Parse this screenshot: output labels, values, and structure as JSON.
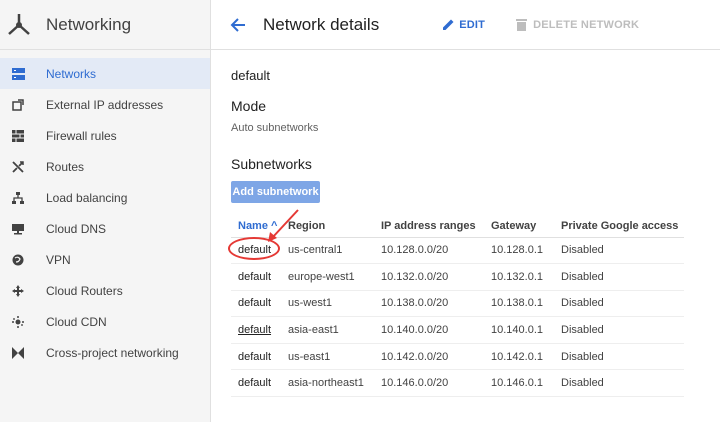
{
  "app": {
    "title": "Networking"
  },
  "sidebar": {
    "items": [
      {
        "label": "Networks",
        "icon": "networks-icon",
        "active": true
      },
      {
        "label": "External IP addresses",
        "icon": "external-ip-icon"
      },
      {
        "label": "Firewall rules",
        "icon": "firewall-icon"
      },
      {
        "label": "Routes",
        "icon": "routes-icon"
      },
      {
        "label": "Load balancing",
        "icon": "load-balancing-icon"
      },
      {
        "label": "Cloud DNS",
        "icon": "dns-icon"
      },
      {
        "label": "VPN",
        "icon": "vpn-icon"
      },
      {
        "label": "Cloud Routers",
        "icon": "routers-icon"
      },
      {
        "label": "Cloud CDN",
        "icon": "cdn-icon"
      },
      {
        "label": "Cross-project networking",
        "icon": "cross-project-icon"
      }
    ]
  },
  "header": {
    "title": "Network details",
    "edit_label": "EDIT",
    "delete_label": "DELETE NETWORK"
  },
  "network": {
    "name": "default",
    "mode_heading": "Mode",
    "mode_value": "Auto subnetworks",
    "subnetworks_heading": "Subnetworks",
    "add_button": "Add subnetwork"
  },
  "table": {
    "columns": [
      "Name",
      "Region",
      "IP address ranges",
      "Gateway",
      "Private Google access"
    ],
    "sort_indicator": "^",
    "rows": [
      [
        "default",
        "us-central1",
        "10.128.0.0/20",
        "10.128.0.1",
        "Disabled"
      ],
      [
        "default",
        "europe-west1",
        "10.132.0.0/20",
        "10.132.0.1",
        "Disabled"
      ],
      [
        "default",
        "us-west1",
        "10.138.0.0/20",
        "10.138.0.1",
        "Disabled"
      ],
      [
        "default",
        "asia-east1",
        "10.140.0.0/20",
        "10.140.0.1",
        "Disabled"
      ],
      [
        "default",
        "us-east1",
        "10.142.0.0/20",
        "10.142.0.1",
        "Disabled"
      ],
      [
        "default",
        "asia-northeast1",
        "10.146.0.0/20",
        "10.146.0.1",
        "Disabled"
      ]
    ]
  },
  "colors": {
    "accent": "#2f6cd1",
    "annotation": "#e53935",
    "add_button_bg": "#7ea6e6"
  }
}
